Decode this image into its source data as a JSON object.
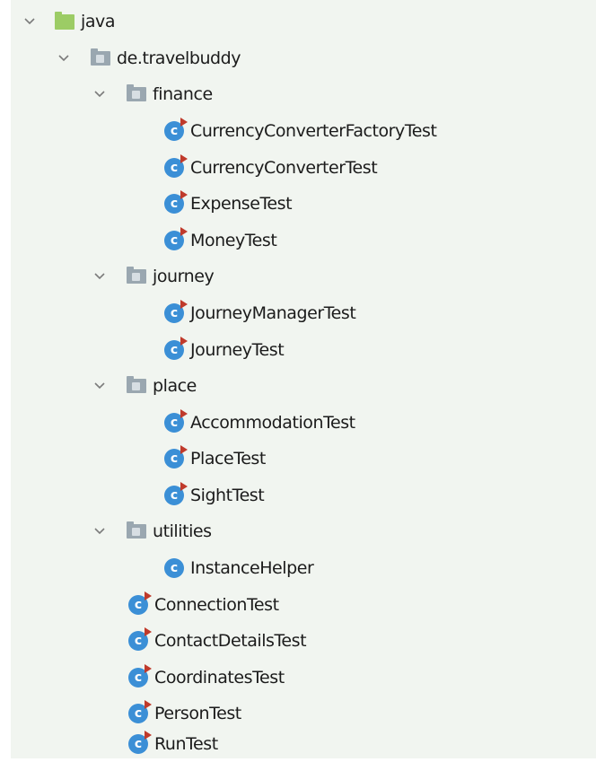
{
  "tree": {
    "root": {
      "label": "java",
      "icon": "source-folder-icon",
      "expanded": true
    },
    "package": {
      "label": "de.travelbuddy",
      "icon": "package-folder-icon",
      "expanded": true
    },
    "subpackages": [
      {
        "label": "finance",
        "icon": "package-folder-icon",
        "expanded": true,
        "children": [
          "CurrencyConverterFactoryTest",
          "CurrencyConverterTest",
          "ExpenseTest",
          "MoneyTest"
        ]
      },
      {
        "label": "journey",
        "icon": "package-folder-icon",
        "expanded": true,
        "children": [
          "JourneyManagerTest",
          "JourneyTest"
        ]
      },
      {
        "label": "place",
        "icon": "package-folder-icon",
        "expanded": true,
        "children": [
          "AccommodationTest",
          "PlaceTest",
          "SightTest"
        ]
      },
      {
        "label": "utilities",
        "icon": "package-folder-icon",
        "expanded": true,
        "children": [
          "InstanceHelper"
        ]
      }
    ],
    "package_classes": [
      "ConnectionTest",
      "ContactDetailsTest",
      "CoordinatesTest",
      "PersonTest",
      "RunTest"
    ]
  },
  "colors": {
    "panel_background": "#f1f5f0",
    "source_folder": "#9ccc65",
    "package_folder": "#9aa7b0",
    "class_icon": "#3b8fd6",
    "test_marker": "#c03a2b"
  }
}
